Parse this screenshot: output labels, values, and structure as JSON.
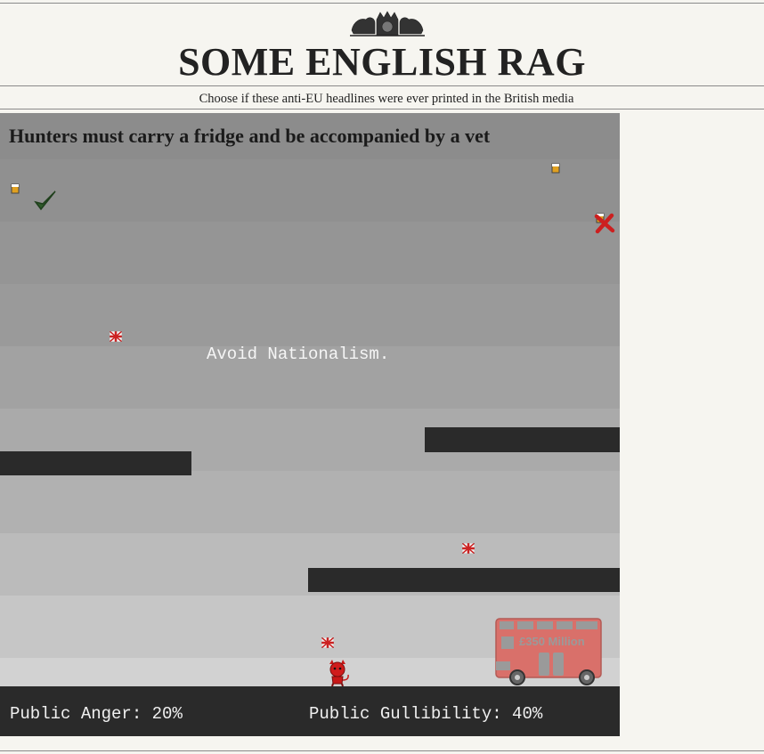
{
  "masthead": {
    "title": "SOME ENGLISH RAG",
    "subtitle": "Choose if these anti-EU headlines were ever printed in the British media",
    "crest_icon": "royal-crest-icon"
  },
  "game": {
    "headline": "Hunters must carry a fridge and be accompanied by a vet",
    "hint": "Avoid Nationalism.",
    "answer_true_icon": "checkmark-icon",
    "answer_false_icon": "cross-icon",
    "pickups": [
      "beer-pint-icon",
      "union-jack-flag-icon"
    ],
    "player_icon": "red-devil-player-icon",
    "bus": {
      "slogan": "£350 Million",
      "icon": "red-bus-icon"
    },
    "colors": {
      "platform": "#2a2a2a",
      "check": "#2e5a2a",
      "cross": "#cc1f1f",
      "bus": "#d9706a"
    }
  },
  "hud": {
    "anger_label": "Public Anger:",
    "anger_value": "20%",
    "gullibility_label": "Public Gullibility:",
    "gullibility_value": "40%"
  }
}
